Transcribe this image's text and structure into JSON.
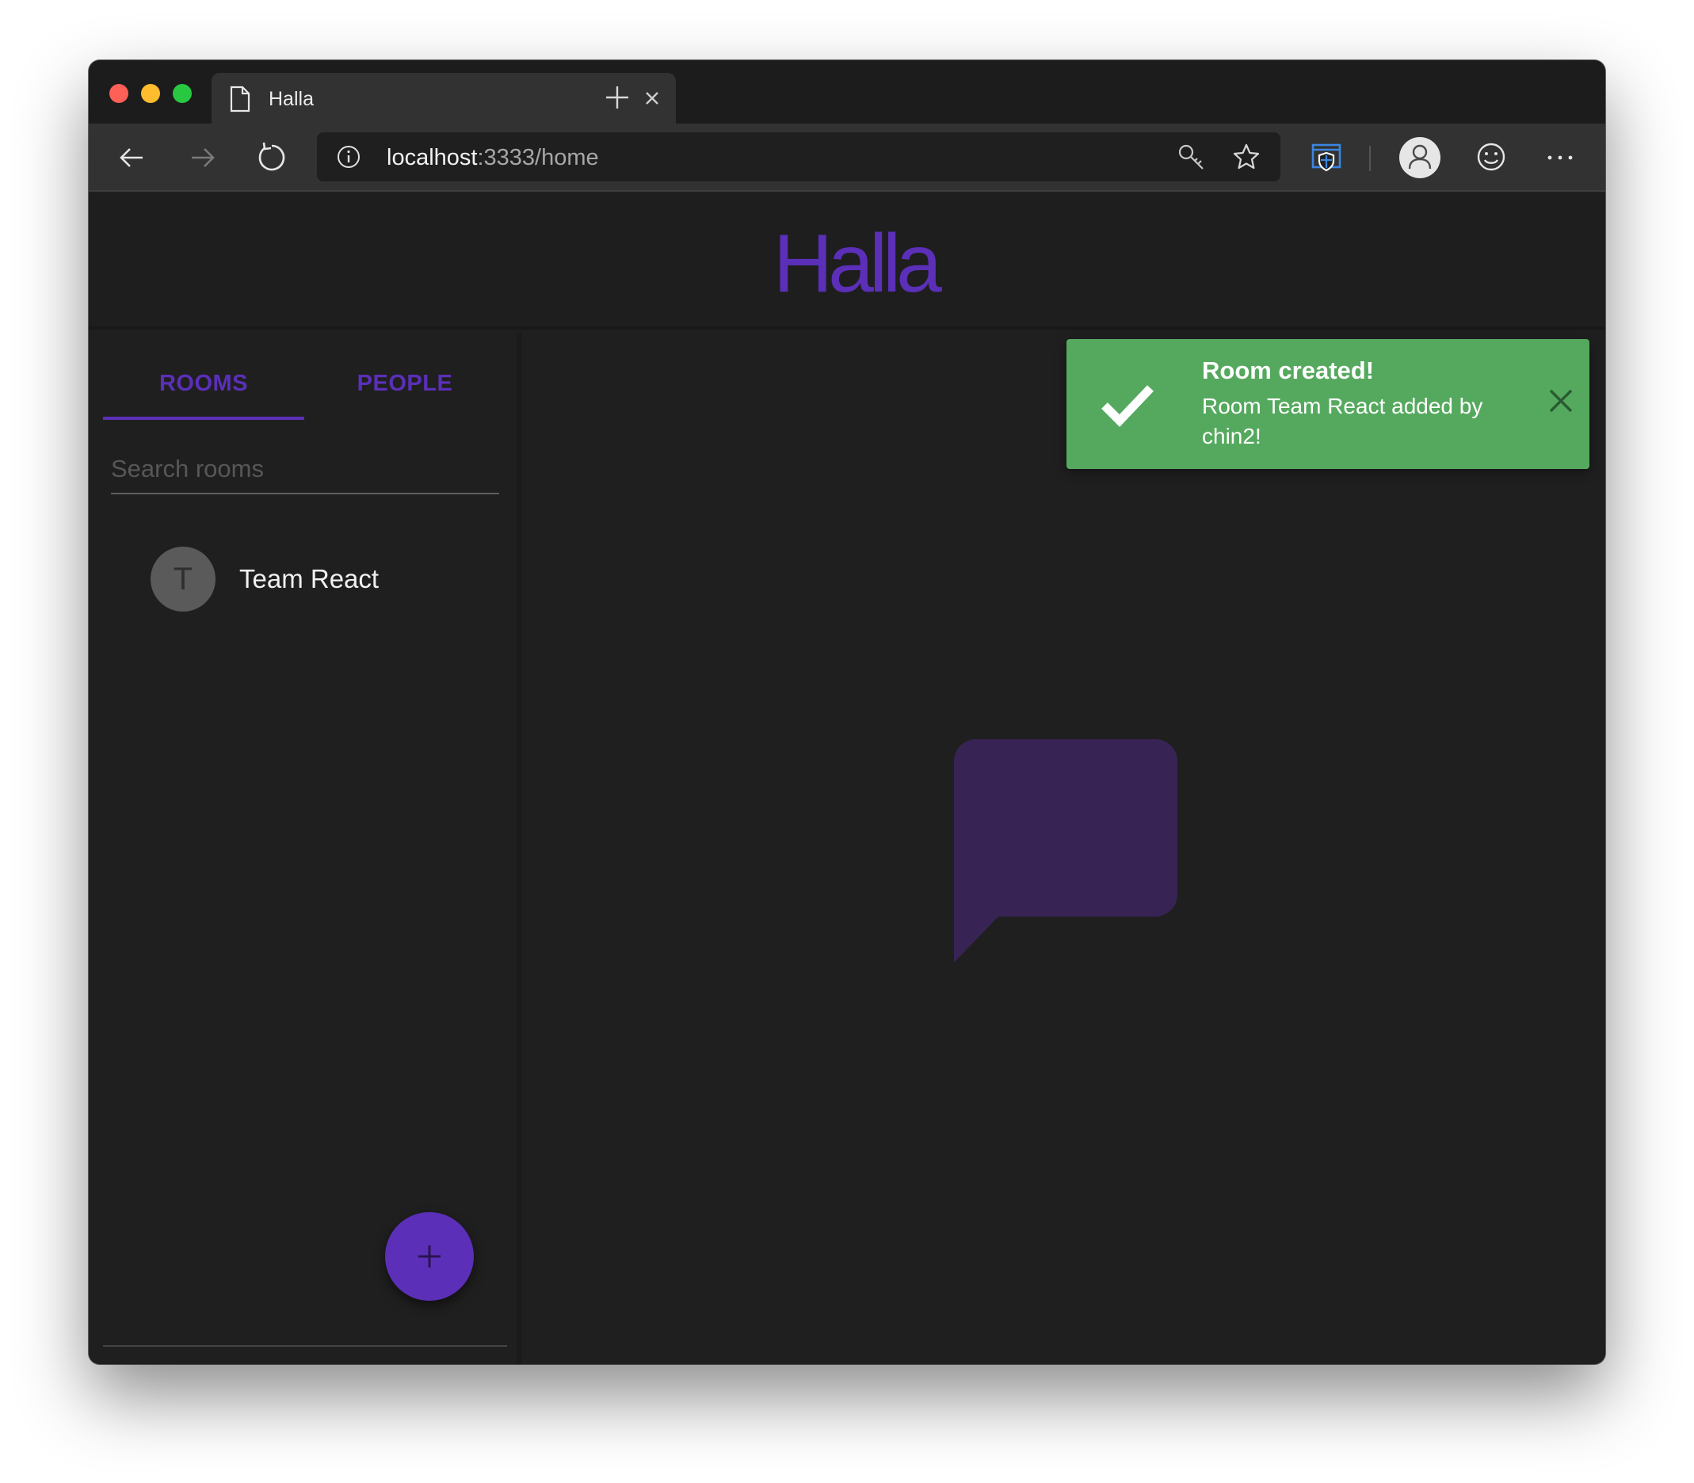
{
  "browser": {
    "tab_title": "Halla",
    "url_host": "localhost",
    "url_rest": ":3333/home"
  },
  "app": {
    "logo_text": "Halla"
  },
  "sidebar": {
    "tabs": [
      {
        "label": "ROOMS",
        "active": true
      },
      {
        "label": "PEOPLE",
        "active": false
      }
    ],
    "search_placeholder": "Search rooms",
    "search_value": "",
    "rooms": [
      {
        "initial": "T",
        "name": "Team React"
      }
    ]
  },
  "toast": {
    "title": "Room created!",
    "message": "Room Team React added by chin2!"
  },
  "colors": {
    "accent": "#5b2fb8",
    "toast_success": "#55a95e",
    "chat_icon": "#372454"
  },
  "icons": [
    "page-icon",
    "close-icon",
    "plus-icon",
    "back-arrow-icon",
    "forward-arrow-icon",
    "reload-icon",
    "info-icon",
    "key-icon",
    "star-icon",
    "shield-icon",
    "profile-icon",
    "smiley-icon",
    "more-icon",
    "checkmark-icon",
    "chat-bubble-icon"
  ]
}
